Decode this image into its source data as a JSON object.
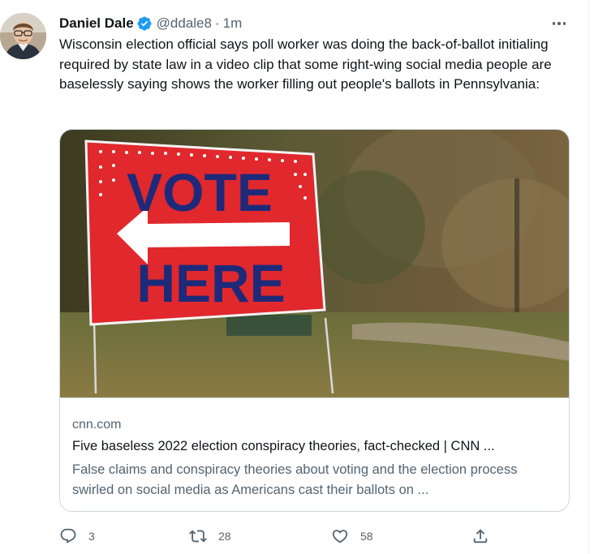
{
  "tweet": {
    "author_name": "Daniel Dale",
    "handle": "@ddale8",
    "separator": "·",
    "time": "1m",
    "text": "Wisconsin election official says poll worker was doing the back-of-ballot initialing required by state law in a video clip that some right-wing social media people are baselessly saying shows the worker filling out people's ballots in Pennsylvania:",
    "verified": true
  },
  "card": {
    "image_sign_line1": "VOTE",
    "image_sign_line2": "HERE",
    "domain": "cnn.com",
    "title": "Five baseless 2022 election conspiracy theories, fact-checked | CNN ...",
    "description": "False claims and conspiracy theories about voting and the election process swirled on social media as Americans cast their ballots on ..."
  },
  "actions": {
    "reply_count": "3",
    "retweet_count": "28",
    "like_count": "58"
  },
  "icons": [
    "verified-badge-icon",
    "more-icon",
    "reply-icon",
    "retweet-icon",
    "like-icon",
    "share-icon"
  ],
  "colors": {
    "verified": "#1d9bf0",
    "secondary_text": "#536471",
    "sign_red": "#e0282d",
    "sign_blue": "#1d2a7a"
  }
}
